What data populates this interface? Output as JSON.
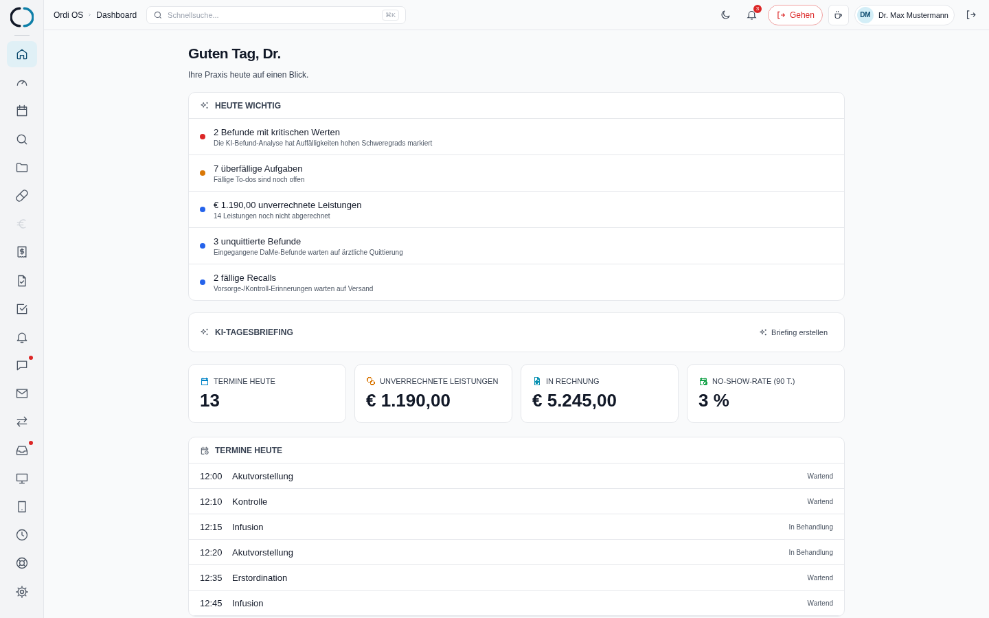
{
  "header": {
    "breadcrumb": [
      "Ordi OS",
      "Dashboard"
    ],
    "search": {
      "placeholder": "Schnellsuche...",
      "shortcut": "⌘K"
    },
    "notifications": {
      "count": "3"
    },
    "leave_button": "Gehen",
    "user": {
      "initials": "DM",
      "name": "Dr. Max Mustermann"
    }
  },
  "sidebar": {
    "items": [
      {
        "kind": "home",
        "selected": true,
        "disabled": false,
        "badge": false
      },
      {
        "kind": "gauge",
        "selected": false,
        "disabled": false,
        "badge": false
      },
      {
        "kind": "calendar",
        "selected": false,
        "disabled": false,
        "badge": false
      },
      {
        "kind": "search",
        "selected": false,
        "disabled": false,
        "badge": false
      },
      {
        "kind": "folder",
        "selected": false,
        "disabled": false,
        "badge": false
      },
      {
        "kind": "pill",
        "selected": false,
        "disabled": false,
        "badge": false
      },
      {
        "kind": "euro",
        "selected": false,
        "disabled": true,
        "badge": false
      },
      {
        "kind": "receipt",
        "selected": false,
        "disabled": false,
        "badge": false
      },
      {
        "kind": "filecheck",
        "selected": false,
        "disabled": false,
        "badge": false
      },
      {
        "kind": "checkbox",
        "selected": false,
        "disabled": false,
        "badge": false
      },
      {
        "kind": "bell",
        "selected": false,
        "disabled": false,
        "badge": false
      },
      {
        "kind": "chat",
        "selected": false,
        "disabled": false,
        "badge": true
      },
      {
        "kind": "mail",
        "selected": false,
        "disabled": false,
        "badge": false
      },
      {
        "kind": "arrows",
        "selected": false,
        "disabled": false,
        "badge": false
      },
      {
        "kind": "inbox",
        "selected": false,
        "disabled": false,
        "badge": true
      },
      {
        "kind": "monitor",
        "selected": false,
        "disabled": false,
        "badge": false
      },
      {
        "kind": "tablet",
        "selected": false,
        "disabled": false,
        "badge": false
      },
      {
        "kind": "clock",
        "selected": false,
        "disabled": false,
        "badge": false
      },
      {
        "kind": "lifebuoy",
        "selected": false,
        "disabled": false,
        "badge": false
      },
      {
        "kind": "gear",
        "selected": false,
        "disabled": false,
        "badge": false
      }
    ]
  },
  "greeting": {
    "title": "Guten Tag, Dr.",
    "subtitle": "Ihre Praxis heute auf einen Blick."
  },
  "important": {
    "title": "HEUTE WICHTIG",
    "items": [
      {
        "title": "2 Befunde mit kritischen Werten",
        "detail": "Die KI-Befund-Analyse hat Auffälligkeiten hohen Schweregrads markiert",
        "color": "#dc2626"
      },
      {
        "title": "7 überfällige Aufgaben",
        "detail": "Fällige To-dos sind noch offen",
        "color": "#d97706"
      },
      {
        "title": "€ 1.190,00 unverrechnete Leistungen",
        "detail": "14 Leistungen noch nicht abgerechnet",
        "color": "#2563eb"
      },
      {
        "title": "3 unquittierte Befunde",
        "detail": "Eingegangene DaMe-Befunde warten auf ärztliche Quittierung",
        "color": "#2563eb"
      },
      {
        "title": "2 fällige Recalls",
        "detail": "Vorsorge-/Kontroll-Erinnerungen warten auf Versand",
        "color": "#2563eb"
      }
    ]
  },
  "briefing": {
    "title": "KI-TAGESBRIEFING",
    "button": "Briefing erstellen"
  },
  "stats": [
    {
      "kind": "calendar",
      "label": "TERMINE HEUTE",
      "value": "13",
      "color": "#0284c7"
    },
    {
      "kind": "coins",
      "label": "UNVERRECHNETE LEISTUNGEN",
      "value": "€ 1.190,00",
      "color": "#d97706"
    },
    {
      "kind": "invoice",
      "label": "IN RECHNUNG",
      "value": "€ 5.245,00",
      "color": "#0891b2"
    },
    {
      "kind": "calclock",
      "label": "NO-SHOW-RATE (90 T.)",
      "value": "3 %",
      "color": "#16a34a"
    }
  ],
  "appointments": {
    "title": "TERMINE HEUTE",
    "rows": [
      {
        "time": "12:00",
        "type": "Akutvorstellung",
        "status": "Wartend"
      },
      {
        "time": "12:10",
        "type": "Kontrolle",
        "status": "Wartend"
      },
      {
        "time": "12:15",
        "type": "Infusion",
        "status": "In Behandlung"
      },
      {
        "time": "12:20",
        "type": "Akutvorstellung",
        "status": "In Behandlung"
      },
      {
        "time": "12:35",
        "type": "Erstordination",
        "status": "Wartend"
      },
      {
        "time": "12:45",
        "type": "Infusion",
        "status": "Wartend"
      }
    ]
  }
}
